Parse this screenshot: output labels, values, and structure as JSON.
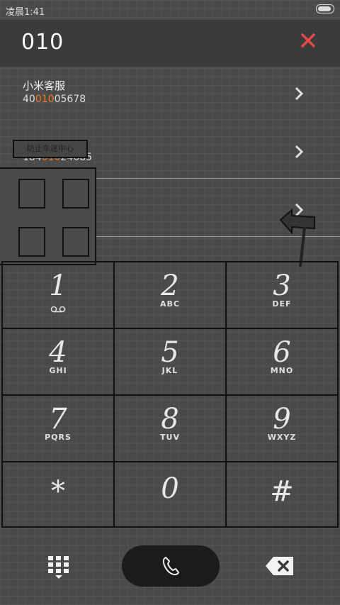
{
  "status": {
    "time": "凌晨1:41"
  },
  "header": {
    "dial_number": "010",
    "close_icon": "close-icon"
  },
  "results": [
    {
      "name": "小米客服",
      "number_pre": "40",
      "number_hl": "010",
      "number_post": "05678"
    },
    {
      "name": "",
      "number_pre": "184",
      "number_hl": "010",
      "number_post": "24685"
    }
  ],
  "sign": {
    "text": "防止车迷中心"
  },
  "keypad": {
    "keys": [
      {
        "digit": "1",
        "letters": ""
      },
      {
        "digit": "2",
        "letters": "ABC"
      },
      {
        "digit": "3",
        "letters": "DEF"
      },
      {
        "digit": "4",
        "letters": "GHI"
      },
      {
        "digit": "5",
        "letters": "JKL"
      },
      {
        "digit": "6",
        "letters": "MNO"
      },
      {
        "digit": "7",
        "letters": "PQRS"
      },
      {
        "digit": "8",
        "letters": "TUV"
      },
      {
        "digit": "9",
        "letters": "WXYZ"
      },
      {
        "digit": "*",
        "letters": ""
      },
      {
        "digit": "0",
        "letters": ""
      },
      {
        "digit": "#",
        "letters": ""
      }
    ]
  },
  "bottombar": {
    "keypad_icon": "dialpad-icon",
    "call_icon": "phone-icon",
    "delete_icon": "backspace-icon"
  },
  "colors": {
    "accent": "#f07a2a",
    "close": "#e34a4a",
    "background": "#4a4a4a"
  }
}
